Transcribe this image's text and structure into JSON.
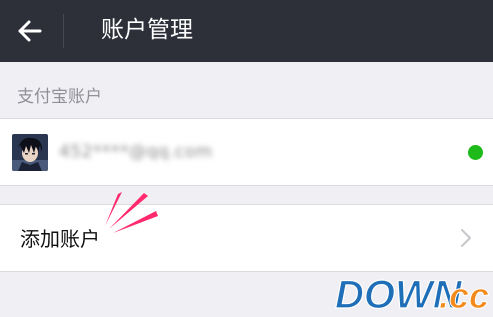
{
  "header": {
    "title": "账户管理",
    "back_icon": "arrow-left-icon"
  },
  "alipay_section": {
    "heading": "支付宝账户",
    "account": {
      "name": "452****@qq.com",
      "status_color": "#1dba1a"
    }
  },
  "add_account": {
    "label": "添加账户",
    "icon": "chevron-right-icon"
  },
  "watermark": {
    "text_main": "DOWN",
    "text_suffix": ".cc"
  },
  "colors": {
    "topbar": "#2d3039",
    "background": "#efeff4",
    "accent_burst": "#ff2a6d"
  }
}
